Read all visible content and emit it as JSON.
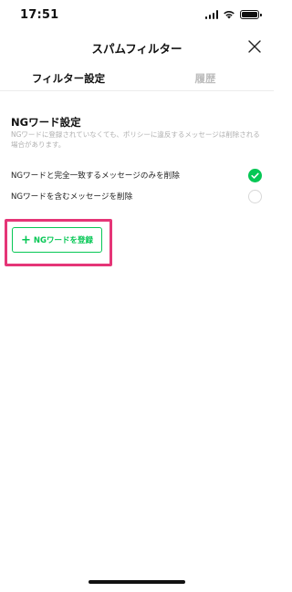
{
  "status_bar": {
    "time": "17:51"
  },
  "header": {
    "title": "スパムフィルター"
  },
  "tabs": [
    {
      "label": "フィルター設定",
      "active": true
    },
    {
      "label": "履歴",
      "active": false
    }
  ],
  "ng_section": {
    "title": "NGワード設定",
    "description": "NGワードに登録されていなくても、ポリシーに違反するメッセージは削除される場合があります。",
    "options": [
      {
        "label": "NGワードと完全一致するメッセージのみを削除",
        "selected": true
      },
      {
        "label": "NGワードを含むメッセージを削除",
        "selected": false
      }
    ],
    "add_button": {
      "icon": "plus-icon",
      "label": "NGワードを登録"
    }
  },
  "colors": {
    "accent": "#06c755",
    "highlight": "#e53577"
  }
}
